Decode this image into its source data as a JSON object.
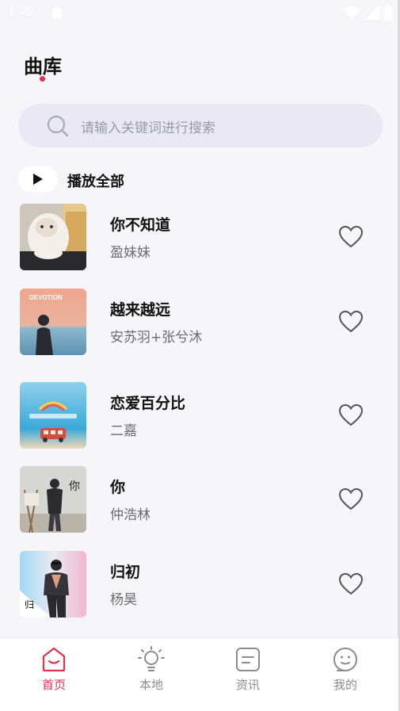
{
  "status_bar": {
    "time": "1:49"
  },
  "header": {
    "title": "曲库"
  },
  "search": {
    "placeholder": "请输入关键词进行搜索"
  },
  "play_all": {
    "label": "播放全部"
  },
  "songs": [
    {
      "title": "你不知道",
      "artist": "盈妹妹"
    },
    {
      "title": "越来越远",
      "artist": "安苏羽+张兮沐",
      "cover_text": "DEVOTION"
    },
    {
      "title": "恋爱百分比",
      "artist": "二嘉"
    },
    {
      "title": "你",
      "artist": "仲浩林"
    },
    {
      "title": "归初",
      "artist": "杨昊"
    }
  ],
  "tabs": [
    {
      "label": "首页",
      "icon": "home-icon",
      "active": true
    },
    {
      "label": "本地",
      "icon": "bulb-icon",
      "active": false
    },
    {
      "label": "资讯",
      "icon": "news-icon",
      "active": false
    },
    {
      "label": "我的",
      "icon": "profile-icon",
      "active": false
    }
  ],
  "colors": {
    "accent": "#e3334c",
    "search_bg": "#e8e9f5",
    "background": "#f5f5fa"
  }
}
